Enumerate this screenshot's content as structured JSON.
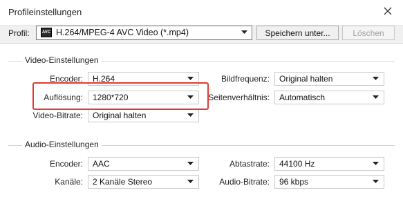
{
  "window": {
    "title": "Profileinstellungen"
  },
  "profile": {
    "label": "Profil:",
    "icon_text": "AVC",
    "value": "H.264/MPEG-4 AVC Video (*.mp4)",
    "save_label": "Speichern unter...",
    "delete_label": "Löschen"
  },
  "video": {
    "heading": "Video-Einstellungen",
    "encoder": {
      "label": "Encoder:",
      "value": "H.264"
    },
    "resolution": {
      "label": "Auflösung:",
      "value": "1280*720"
    },
    "bitrate": {
      "label": "Video-Bitrate:",
      "value": "Original halten"
    },
    "framerate": {
      "label": "Bildfrequenz:",
      "value": "Original halten"
    },
    "aspect": {
      "label": "Seitenverhältnis:",
      "value": "Automatisch"
    }
  },
  "audio": {
    "heading": "Audio-Einstellungen",
    "encoder": {
      "label": "Encoder:",
      "value": "AAC"
    },
    "channels": {
      "label": "Kanäle:",
      "value": "2 Kanäle Stereo"
    },
    "samplerate": {
      "label": "Abtastrate:",
      "value": "44100 Hz"
    },
    "bitrate": {
      "label": "Audio-Bitrate:",
      "value": "96 kbps"
    }
  },
  "colors": {
    "highlight": "#e03a31"
  }
}
